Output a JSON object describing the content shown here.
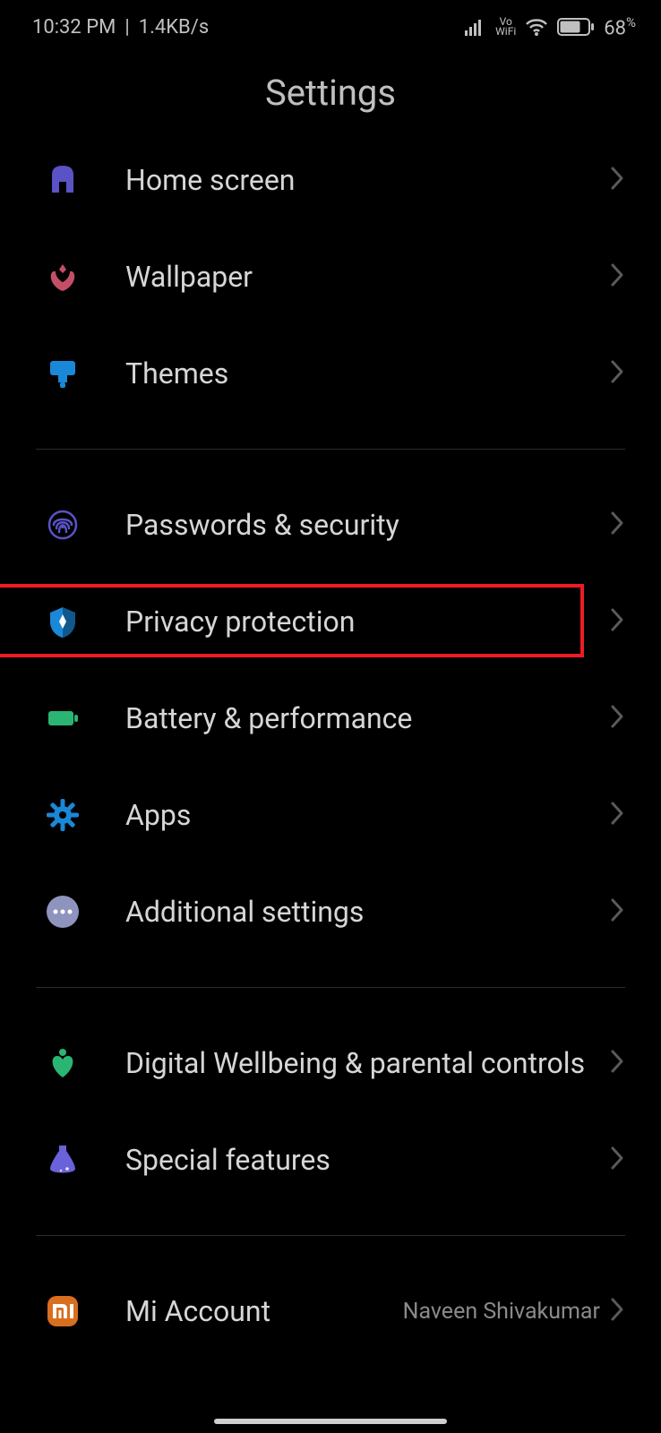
{
  "status": {
    "time": "10:32 PM",
    "separator": "|",
    "speed": "1.4KB/s",
    "vowifi_top": "Vo",
    "vowifi_bottom": "WiFi",
    "battery": "68",
    "battery_sign": "%"
  },
  "title": "Settings",
  "groups": [
    {
      "items": [
        {
          "key": "home-screen",
          "label": "Home screen",
          "icon": "home",
          "color": "#5a52c5"
        },
        {
          "key": "wallpaper",
          "label": "Wallpaper",
          "icon": "flower",
          "color": "#c34f67"
        },
        {
          "key": "themes",
          "label": "Themes",
          "icon": "brush",
          "color": "#1a88d8"
        }
      ]
    },
    {
      "items": [
        {
          "key": "passwords-security",
          "label": "Passwords & security",
          "icon": "fingerprint",
          "color": "#5a52c5"
        },
        {
          "key": "privacy-protection",
          "label": "Privacy protection",
          "icon": "shield",
          "color": "#1a88d8",
          "highlighted": true
        },
        {
          "key": "battery-performance",
          "label": "Battery & performance",
          "icon": "battery",
          "color": "#2bb573"
        },
        {
          "key": "apps",
          "label": "Apps",
          "icon": "gear",
          "color": "#1a88d8"
        },
        {
          "key": "additional-settings",
          "label": "Additional settings",
          "icon": "dots",
          "color": "#8e94bd"
        }
      ]
    },
    {
      "items": [
        {
          "key": "digital-wellbeing",
          "label": "Digital Wellbeing & parental controls",
          "icon": "heart",
          "color": "#2bb573"
        },
        {
          "key": "special-features",
          "label": "Special features",
          "icon": "flask",
          "color": "#6a62d8"
        }
      ]
    },
    {
      "items": [
        {
          "key": "mi-account",
          "label": "Mi Account",
          "icon": "mi",
          "color": "#d96e1f",
          "secondary": "Naveen Shivakumar"
        }
      ]
    }
  ]
}
